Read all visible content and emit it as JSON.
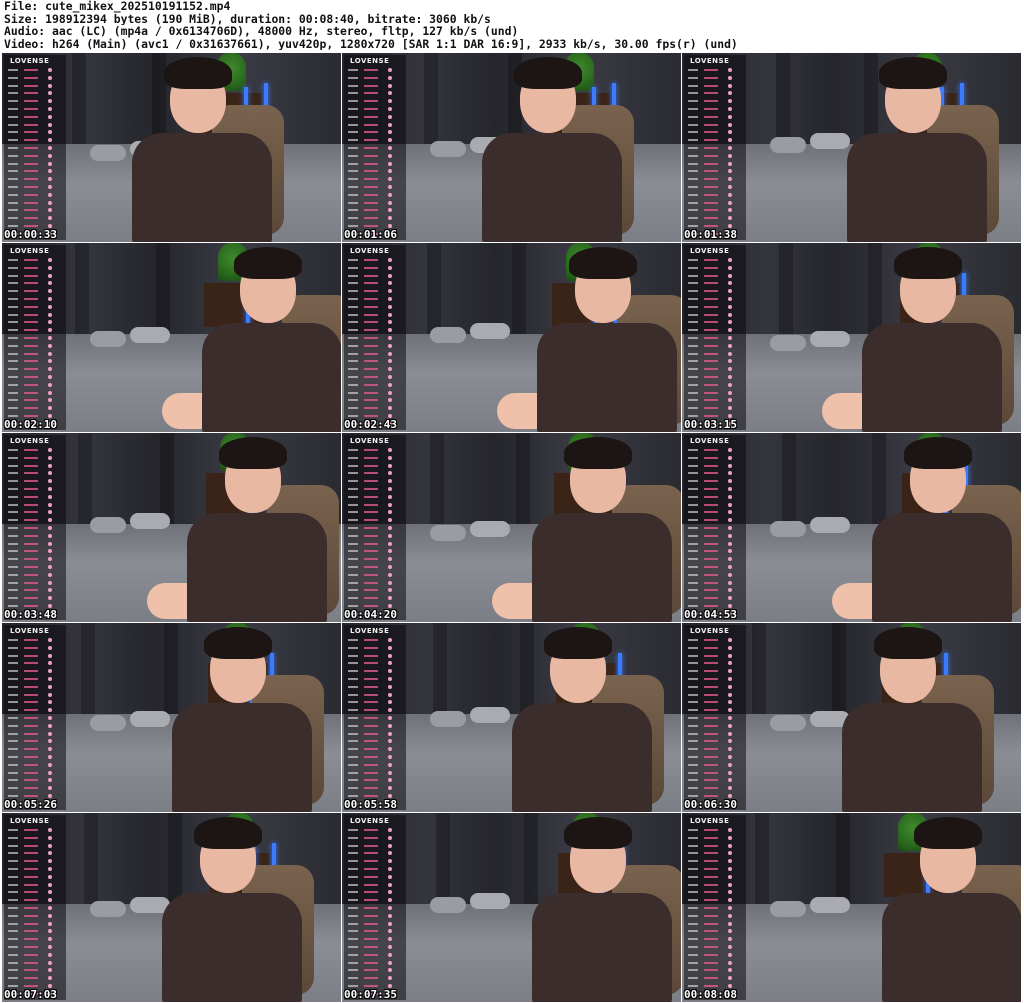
{
  "header": {
    "file": "File: cute_mikex_202510191152.mp4",
    "size": "Size: 198912394 bytes (190 MiB), duration: 00:08:40, bitrate: 3060 kb/s",
    "audio": "Audio: aac (LC) (mp4a / 0x6134706D), 48000 Hz, stereo, fltp, 127 kb/s (und)",
    "video": "Video: h264 (Main) (avc1 / 0x31637661), yuv420p, 1280x720 [SAR 1:1 DAR 16:9], 2933 kb/s, 30.00 fps(r) (und)"
  },
  "overlay_brand": "LOVENSE",
  "thumbnails": [
    {
      "timestamp": "00:00:33"
    },
    {
      "timestamp": "00:01:06"
    },
    {
      "timestamp": "00:01:38"
    },
    {
      "timestamp": "00:02:10"
    },
    {
      "timestamp": "00:02:43"
    },
    {
      "timestamp": "00:03:15"
    },
    {
      "timestamp": "00:03:48"
    },
    {
      "timestamp": "00:04:20"
    },
    {
      "timestamp": "00:04:53"
    },
    {
      "timestamp": "00:05:26"
    },
    {
      "timestamp": "00:05:58"
    },
    {
      "timestamp": "00:06:30"
    },
    {
      "timestamp": "00:07:03"
    },
    {
      "timestamp": "00:07:35"
    },
    {
      "timestamp": "00:08:08"
    }
  ],
  "colors": {
    "background": "#ffffff",
    "header_text": "#111111",
    "timestamp_text": "#ffffff",
    "shirt": "#3a2d2b",
    "neon": "#3a7bff"
  }
}
